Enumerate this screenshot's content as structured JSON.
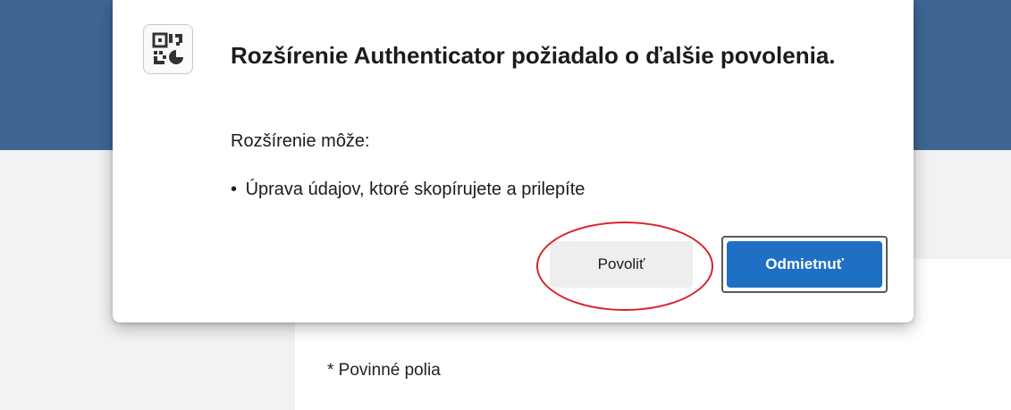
{
  "page": {
    "required_fields_note": "* Povinné polia"
  },
  "dialog": {
    "icon": "qr-code-icon",
    "title": "Rozšírenie Authenticator požiadalo o ďalšie povolenia.",
    "subheading": "Rozšírenie môže:",
    "permissions": [
      {
        "bullet": "•",
        "text": "Úprava údajov, ktoré skopírujete a prilepíte"
      }
    ],
    "buttons": {
      "allow_label": "Povoliť",
      "deny_label": "Odmietnuť"
    }
  },
  "colors": {
    "header": "#3e6594",
    "primary_button": "#1f6fc4",
    "secondary_button": "#eeeeee",
    "highlight": "#d8232a"
  },
  "annotation": {
    "type": "ellipse",
    "target": "allow-button"
  }
}
